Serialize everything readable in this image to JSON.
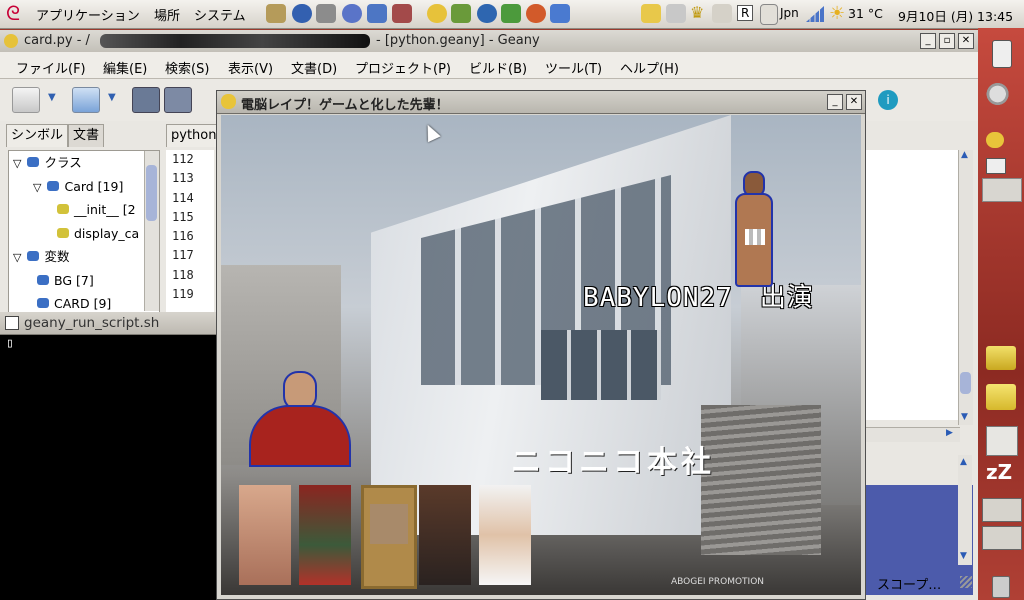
{
  "panel": {
    "menus": [
      "アプリケーション",
      "場所",
      "システム"
    ],
    "weather": "31 °C",
    "clock": "9月10日 (月) 13:45",
    "ime": "Jpn",
    "ime_r": "R"
  },
  "geany": {
    "title": "card.py - /",
    "title_suffix": "- [python.geany] - Geany",
    "menus": [
      "ファイル(F)",
      "編集(E)",
      "検索(S)",
      "表示(V)",
      "文書(D)",
      "プロジェクト(P)",
      "ビルド(B)",
      "ツール(T)",
      "ヘルプ(H)"
    ],
    "side_tabs": [
      "シンボル",
      "文書"
    ],
    "editor_tab": "python",
    "tree": [
      {
        "label": "クラス",
        "indent": 0,
        "arrow": "▽"
      },
      {
        "label": "Card [19]",
        "indent": 1,
        "arrow": "▽"
      },
      {
        "label": "__init__ [2",
        "indent": 2,
        "arrow": ""
      },
      {
        "label": "display_ca",
        "indent": 2,
        "arrow": ""
      },
      {
        "label": "変数",
        "indent": 0,
        "arrow": "▽"
      },
      {
        "label": "BG [7]",
        "indent": 1,
        "arrow": ""
      },
      {
        "label": "CARD [9]",
        "indent": 1,
        "arrow": ""
      }
    ],
    "line_numbers": [
      "112",
      "113",
      "114",
      "115",
      "116",
      "117",
      "118",
      "119"
    ],
    "scope_label": "スコープ…"
  },
  "terminal": {
    "title": "geany_run_script.sh",
    "cursor": "▯"
  },
  "game": {
    "title": "電脳レイプ！ゲームと化した先輩！",
    "banner": "BABYLON27　出演",
    "building_sign": "ニコニコ本社",
    "shirt_text": "ABOGEI PROMOTION"
  },
  "colors": {
    "desktop": "#9a3a2e",
    "selection_blue": "#4c5bab"
  }
}
